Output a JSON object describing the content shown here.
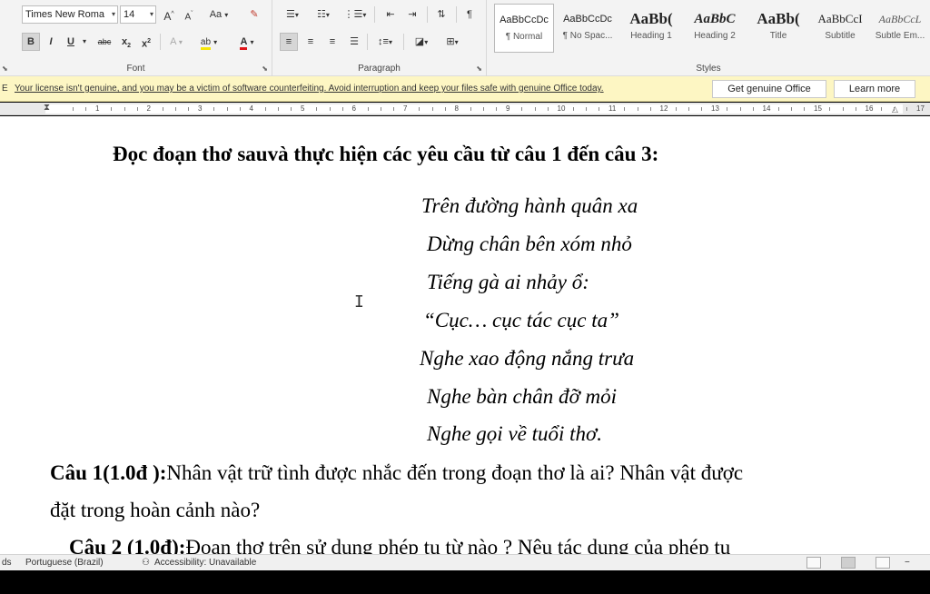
{
  "font_group": {
    "label": "Font",
    "font_name": "Times New Roma",
    "font_size": "14",
    "grow_label": "A",
    "shrink_label": "A",
    "case_label": "Aa",
    "bold_label": "B",
    "italic_label": "I",
    "underline_label": "U",
    "strike_label": "abc",
    "subscript_label": "x",
    "superscript_label": "x",
    "effects_label": "A",
    "font_color_label": "A",
    "highlight_label": "ab"
  },
  "paragraph_group": {
    "label": "Paragraph",
    "show_marks_label": "¶"
  },
  "styles_group": {
    "label": "Styles",
    "items": [
      {
        "sample": "AaBbCcDc",
        "name": "¶ Normal"
      },
      {
        "sample": "AaBbCcDc",
        "name": "¶ No Spac..."
      },
      {
        "sample": "AaBb(",
        "name": "Heading 1"
      },
      {
        "sample": "AaBbC",
        "name": "Heading 2"
      },
      {
        "sample": "AaBb(",
        "name": "Title"
      },
      {
        "sample": "AaBbCcI",
        "name": "Subtitle"
      },
      {
        "sample": "AaBbCcL",
        "name": "Subtle Em..."
      }
    ]
  },
  "license_bar": {
    "prefix": "E",
    "message": "Your license isn't genuine, and you may be a victim of software counterfeiting. Avoid interruption and keep your files safe with genuine Office today.",
    "primary_button": "Get genuine Office",
    "secondary_button": "Learn more"
  },
  "ruler": {
    "numbers": [
      "1",
      "2",
      "3",
      "4",
      "5",
      "6",
      "7",
      "8",
      "9",
      "10",
      "11",
      "12",
      "13",
      "14",
      "15",
      "16",
      "17"
    ]
  },
  "document": {
    "heading": "Đọc đoạn thơ sauvà thực hiện các yêu cầu từ câu 1 đến câu 3:",
    "poem": [
      "Trên đường hành quân xa",
      "Dừng chân bên xóm nhỏ",
      "Tiếng gà ai nhảy ổ:",
      "“Cục… cục tác cục ta”",
      "Nghe xao động nắng trưa",
      "Nghe bàn chân đỡ mỏi",
      "Nghe gọi về tuổi thơ."
    ],
    "q1_label": "Câu 1(1.0đ ):",
    "q1_text": "Nhân vật trữ tình được nhắc đến trong đoạn thơ là ai? Nhân vật được",
    "q1_cont": "đặt trong hoàn cảnh nào?",
    "q2_label": "Câu 2 (1.0đ):",
    "q2_text": "Đoạn thơ trên sử dụng phép tu từ nào ? Nêu tác dụng của phép tu"
  },
  "status_bar": {
    "words_fragment": "ds",
    "language": "Portuguese (Brazil)",
    "accessibility": "Accessibility: Unavailable",
    "zoom_minus": "−"
  }
}
